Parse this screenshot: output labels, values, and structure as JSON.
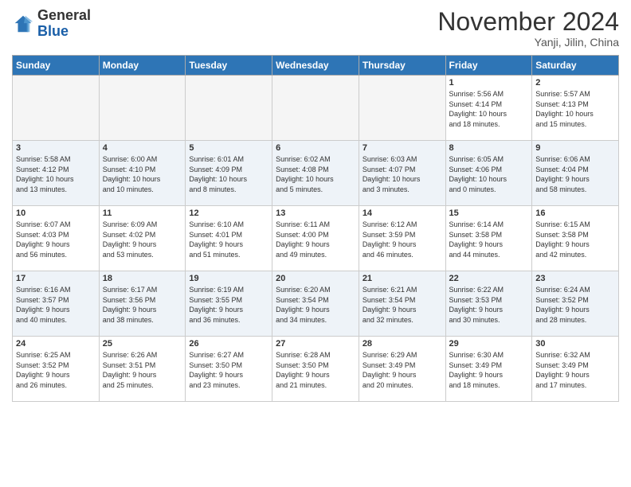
{
  "header": {
    "logo_general": "General",
    "logo_blue": "Blue",
    "month_title": "November 2024",
    "location": "Yanji, Jilin, China"
  },
  "weekdays": [
    "Sunday",
    "Monday",
    "Tuesday",
    "Wednesday",
    "Thursday",
    "Friday",
    "Saturday"
  ],
  "weeks": [
    [
      {
        "day": "",
        "info": ""
      },
      {
        "day": "",
        "info": ""
      },
      {
        "day": "",
        "info": ""
      },
      {
        "day": "",
        "info": ""
      },
      {
        "day": "",
        "info": ""
      },
      {
        "day": "1",
        "info": "Sunrise: 5:56 AM\nSunset: 4:14 PM\nDaylight: 10 hours\nand 18 minutes."
      },
      {
        "day": "2",
        "info": "Sunrise: 5:57 AM\nSunset: 4:13 PM\nDaylight: 10 hours\nand 15 minutes."
      }
    ],
    [
      {
        "day": "3",
        "info": "Sunrise: 5:58 AM\nSunset: 4:12 PM\nDaylight: 10 hours\nand 13 minutes."
      },
      {
        "day": "4",
        "info": "Sunrise: 6:00 AM\nSunset: 4:10 PM\nDaylight: 10 hours\nand 10 minutes."
      },
      {
        "day": "5",
        "info": "Sunrise: 6:01 AM\nSunset: 4:09 PM\nDaylight: 10 hours\nand 8 minutes."
      },
      {
        "day": "6",
        "info": "Sunrise: 6:02 AM\nSunset: 4:08 PM\nDaylight: 10 hours\nand 5 minutes."
      },
      {
        "day": "7",
        "info": "Sunrise: 6:03 AM\nSunset: 4:07 PM\nDaylight: 10 hours\nand 3 minutes."
      },
      {
        "day": "8",
        "info": "Sunrise: 6:05 AM\nSunset: 4:06 PM\nDaylight: 10 hours\nand 0 minutes."
      },
      {
        "day": "9",
        "info": "Sunrise: 6:06 AM\nSunset: 4:04 PM\nDaylight: 9 hours\nand 58 minutes."
      }
    ],
    [
      {
        "day": "10",
        "info": "Sunrise: 6:07 AM\nSunset: 4:03 PM\nDaylight: 9 hours\nand 56 minutes."
      },
      {
        "day": "11",
        "info": "Sunrise: 6:09 AM\nSunset: 4:02 PM\nDaylight: 9 hours\nand 53 minutes."
      },
      {
        "day": "12",
        "info": "Sunrise: 6:10 AM\nSunset: 4:01 PM\nDaylight: 9 hours\nand 51 minutes."
      },
      {
        "day": "13",
        "info": "Sunrise: 6:11 AM\nSunset: 4:00 PM\nDaylight: 9 hours\nand 49 minutes."
      },
      {
        "day": "14",
        "info": "Sunrise: 6:12 AM\nSunset: 3:59 PM\nDaylight: 9 hours\nand 46 minutes."
      },
      {
        "day": "15",
        "info": "Sunrise: 6:14 AM\nSunset: 3:58 PM\nDaylight: 9 hours\nand 44 minutes."
      },
      {
        "day": "16",
        "info": "Sunrise: 6:15 AM\nSunset: 3:58 PM\nDaylight: 9 hours\nand 42 minutes."
      }
    ],
    [
      {
        "day": "17",
        "info": "Sunrise: 6:16 AM\nSunset: 3:57 PM\nDaylight: 9 hours\nand 40 minutes."
      },
      {
        "day": "18",
        "info": "Sunrise: 6:17 AM\nSunset: 3:56 PM\nDaylight: 9 hours\nand 38 minutes."
      },
      {
        "day": "19",
        "info": "Sunrise: 6:19 AM\nSunset: 3:55 PM\nDaylight: 9 hours\nand 36 minutes."
      },
      {
        "day": "20",
        "info": "Sunrise: 6:20 AM\nSunset: 3:54 PM\nDaylight: 9 hours\nand 34 minutes."
      },
      {
        "day": "21",
        "info": "Sunrise: 6:21 AM\nSunset: 3:54 PM\nDaylight: 9 hours\nand 32 minutes."
      },
      {
        "day": "22",
        "info": "Sunrise: 6:22 AM\nSunset: 3:53 PM\nDaylight: 9 hours\nand 30 minutes."
      },
      {
        "day": "23",
        "info": "Sunrise: 6:24 AM\nSunset: 3:52 PM\nDaylight: 9 hours\nand 28 minutes."
      }
    ],
    [
      {
        "day": "24",
        "info": "Sunrise: 6:25 AM\nSunset: 3:52 PM\nDaylight: 9 hours\nand 26 minutes."
      },
      {
        "day": "25",
        "info": "Sunrise: 6:26 AM\nSunset: 3:51 PM\nDaylight: 9 hours\nand 25 minutes."
      },
      {
        "day": "26",
        "info": "Sunrise: 6:27 AM\nSunset: 3:50 PM\nDaylight: 9 hours\nand 23 minutes."
      },
      {
        "day": "27",
        "info": "Sunrise: 6:28 AM\nSunset: 3:50 PM\nDaylight: 9 hours\nand 21 minutes."
      },
      {
        "day": "28",
        "info": "Sunrise: 6:29 AM\nSunset: 3:49 PM\nDaylight: 9 hours\nand 20 minutes."
      },
      {
        "day": "29",
        "info": "Sunrise: 6:30 AM\nSunset: 3:49 PM\nDaylight: 9 hours\nand 18 minutes."
      },
      {
        "day": "30",
        "info": "Sunrise: 6:32 AM\nSunset: 3:49 PM\nDaylight: 9 hours\nand 17 minutes."
      }
    ]
  ]
}
